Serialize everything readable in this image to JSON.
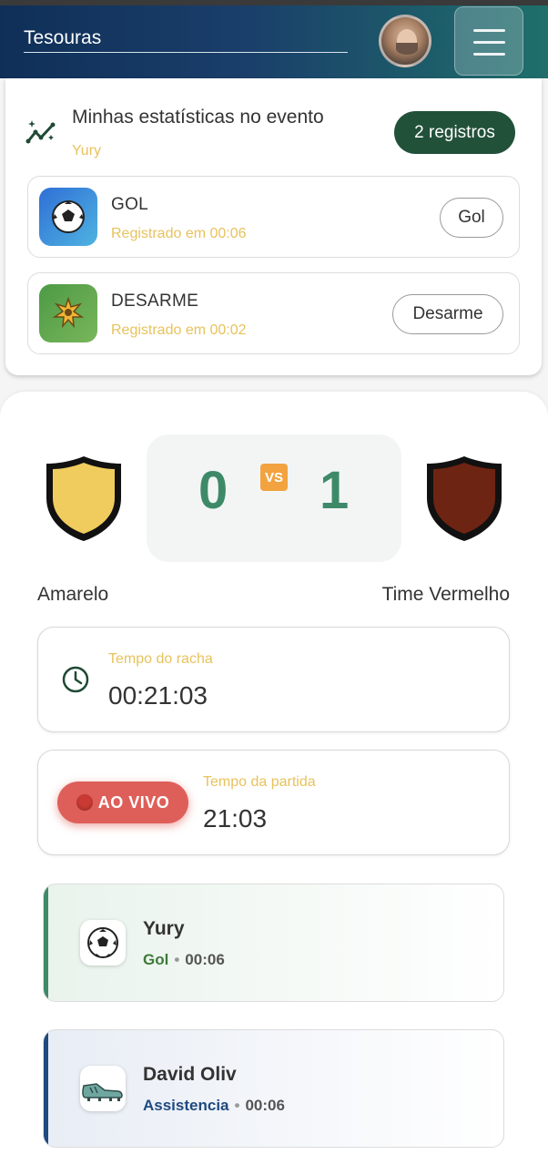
{
  "header": {
    "title": "Tesouras"
  },
  "stats": {
    "title": "Minhas estatísticas no evento",
    "subtitle": "Yury",
    "count_badge": "2 registros",
    "items": [
      {
        "name": "GOL",
        "time": "Registrado em 00:06",
        "button": "Gol",
        "icon": "soccer-ball-icon"
      },
      {
        "name": "DESARME",
        "time": "Registrado em 00:02",
        "button": "Desarme",
        "icon": "gear-star-icon"
      }
    ]
  },
  "match": {
    "home_team": "Amarelo",
    "away_team": "Time Vermelho",
    "home_score": "0",
    "away_score": "1",
    "vs_label": "VS",
    "home_color": "#f0cc5e",
    "away_color": "#6e2412"
  },
  "session_time": {
    "label": "Tempo do racha",
    "value": "00:21:03"
  },
  "match_time": {
    "live_label": "AO VIVO",
    "label": "Tempo da partida",
    "value": "21:03"
  },
  "events": [
    {
      "player": "Yury",
      "type": "Gol",
      "time": "00:06",
      "accent": "#3e8a68",
      "icon": "soccer-ball-icon"
    },
    {
      "player": "David Oliv",
      "type": "Assistencia",
      "time": "00:06",
      "accent": "#1f4a80",
      "icon": "cleat-icon"
    }
  ]
}
